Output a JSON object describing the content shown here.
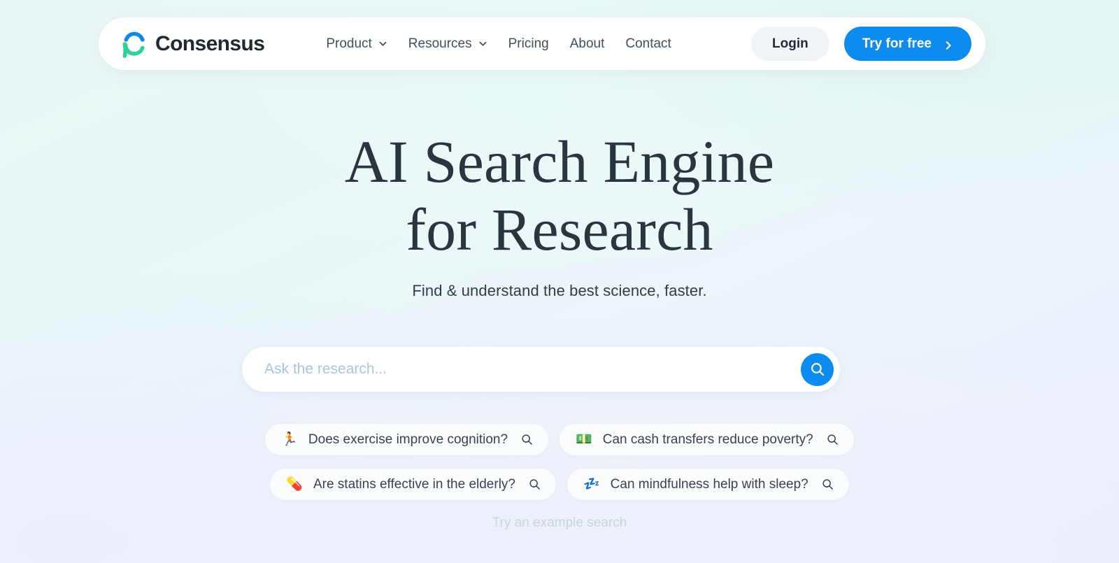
{
  "brand": {
    "name": "Consensus",
    "logo_icon": "consensus-c-logo",
    "logo_blue": "#1486e8",
    "logo_green": "#2fd39a"
  },
  "nav": {
    "items": [
      {
        "label": "Product",
        "has_dropdown": true,
        "icon": "chevron-down-icon"
      },
      {
        "label": "Resources",
        "has_dropdown": true,
        "icon": "chevron-down-icon"
      },
      {
        "label": "Pricing",
        "has_dropdown": false,
        "icon": ""
      },
      {
        "label": "About",
        "has_dropdown": false,
        "icon": ""
      },
      {
        "label": "Contact",
        "has_dropdown": false,
        "icon": ""
      }
    ],
    "login_label": "Login",
    "cta_label": "Try for free",
    "cta_icon": "chevron-right-icon",
    "cta_color": "#0d8bef"
  },
  "hero": {
    "title_line1": "AI Search Engine",
    "title_line2": "for Research",
    "subtitle": "Find & understand the best science, faster."
  },
  "search": {
    "value": "",
    "placeholder": "Ask the research...",
    "submit_icon": "search-icon",
    "submit_color": "#0d8bef"
  },
  "examples": {
    "note": "Try an example search",
    "chips": [
      {
        "emoji": "🏃",
        "emoji_name": "runner-emoji",
        "text": "Does exercise improve cognition?",
        "icon": "search-icon"
      },
      {
        "emoji": "💵",
        "emoji_name": "banknote-emoji",
        "text": "Can cash transfers reduce poverty?",
        "icon": "search-icon"
      },
      {
        "emoji": "💊",
        "emoji_name": "pill-emoji",
        "text": "Are statins effective in the elderly?",
        "icon": "search-icon"
      },
      {
        "emoji": "💤",
        "emoji_name": "sleep-zzz-emoji",
        "text": "Can mindfulness help with sleep?",
        "icon": "search-icon"
      }
    ]
  }
}
